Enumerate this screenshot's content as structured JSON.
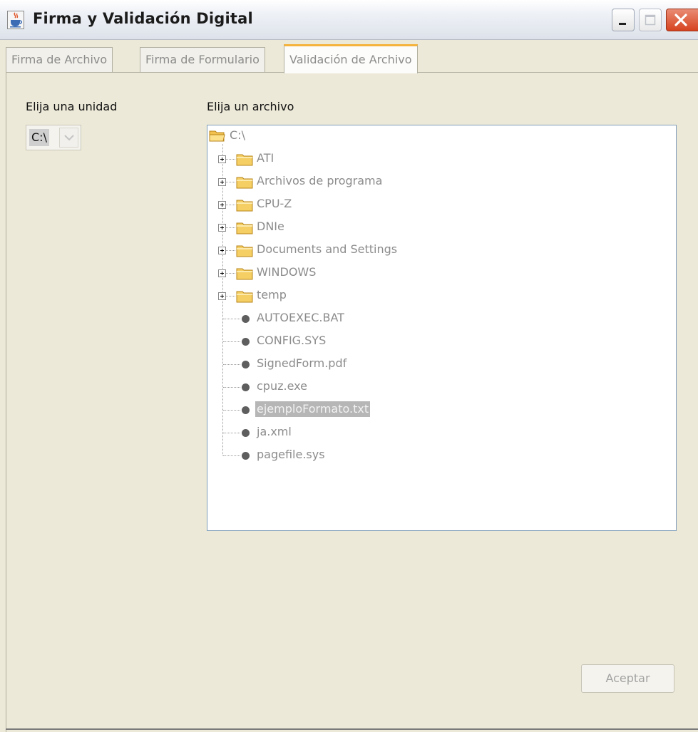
{
  "window": {
    "title": "Firma y Validación Digital",
    "icon": "java-cup-icon",
    "controls": [
      "minimize-icon",
      "maximize-icon",
      "close-icon"
    ]
  },
  "tabs": [
    {
      "label": "Firma de Archivo",
      "active": false
    },
    {
      "label": "Firma de Formulario",
      "active": false
    },
    {
      "label": "Validación de Archivo",
      "active": true
    }
  ],
  "drive": {
    "label": "Elija una unidad",
    "value": "C:\\"
  },
  "file": {
    "label": "Elija un archivo",
    "root": "C:\\",
    "folders": [
      "ATI",
      "Archivos de programa",
      "CPU-Z",
      "DNIe",
      "Documents and Settings",
      "WINDOWS",
      "temp"
    ],
    "files": [
      "AUTOEXEC.BAT",
      "CONFIG.SYS",
      "SignedForm.pdf",
      "cpuz.exe",
      "ejemploFormato.txt",
      "ja.xml",
      "pagefile.sys"
    ],
    "selected": "ejemploFormato.txt"
  },
  "buttons": {
    "accept": "Aceptar"
  },
  "colors": {
    "tab_active_accent": "#f5b33b",
    "selection": "#b6b6b6",
    "close_button": "#d6431f"
  }
}
